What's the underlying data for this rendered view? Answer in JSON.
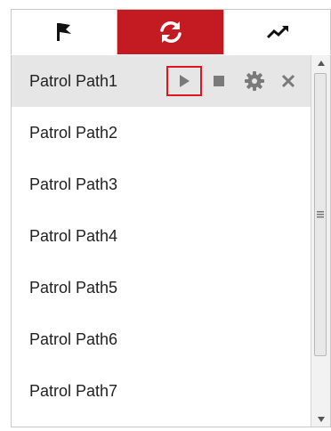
{
  "tabs": [
    {
      "icon": "flag-icon",
      "active": false
    },
    {
      "icon": "refresh-icon",
      "active": true
    },
    {
      "icon": "trend-icon",
      "active": false
    }
  ],
  "colors": {
    "accent": "#c41a22",
    "selected_row": "#e6e6e6",
    "highlight": "#e0161c",
    "icon": "#7a7a7a"
  },
  "patrol_paths": [
    {
      "label": "Patrol Path1",
      "selected": true,
      "controls": [
        "play-icon",
        "stop-icon",
        "gear-icon",
        "close-icon"
      ]
    },
    {
      "label": "Patrol Path2"
    },
    {
      "label": "Patrol Path3"
    },
    {
      "label": "Patrol Path4"
    },
    {
      "label": "Patrol Path5"
    },
    {
      "label": "Patrol Path6"
    },
    {
      "label": "Patrol Path7"
    }
  ]
}
